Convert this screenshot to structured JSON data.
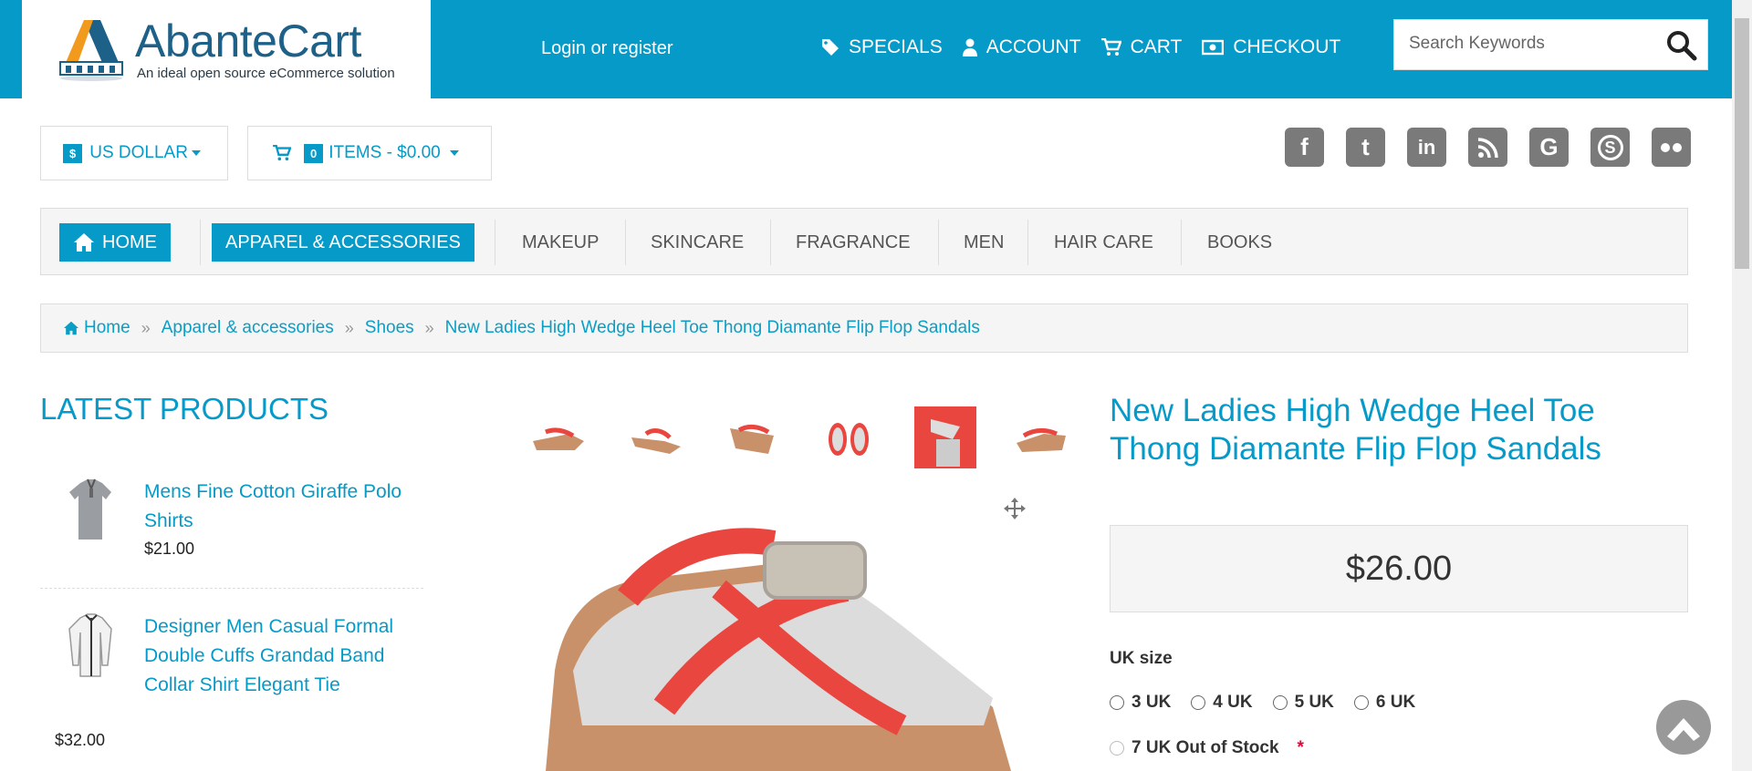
{
  "header": {
    "logo_name": "AbanteCart",
    "logo_tagline": "An ideal open source eCommerce solution",
    "login": "Login or register",
    "nav": [
      {
        "label": "SPECIALS",
        "icon": "tag-icon"
      },
      {
        "label": "ACCOUNT",
        "icon": "user-icon"
      },
      {
        "label": "CART",
        "icon": "cart-icon"
      },
      {
        "label": "CHECKOUT",
        "icon": "money-icon"
      }
    ],
    "search_placeholder": "Search Keywords"
  },
  "toolbar": {
    "currency_badge": "$",
    "currency_label": "US DOLLAR",
    "cart_count": "0",
    "cart_label": "ITEMS - $0.00"
  },
  "social": [
    "facebook-icon",
    "twitter-icon",
    "linkedin-icon",
    "rss-icon",
    "google-icon",
    "skype-icon",
    "flickr-icon"
  ],
  "categories": [
    {
      "label": "HOME",
      "active": true
    },
    {
      "label": "APPAREL & ACCESSORIES",
      "active": true
    },
    {
      "label": "MAKEUP",
      "active": false
    },
    {
      "label": "SKINCARE",
      "active": false
    },
    {
      "label": "FRAGRANCE",
      "active": false
    },
    {
      "label": "MEN",
      "active": false
    },
    {
      "label": "HAIR CARE",
      "active": false
    },
    {
      "label": "BOOKS",
      "active": false
    }
  ],
  "breadcrumb": [
    "Home",
    "Apparel & accessories",
    "Shoes",
    "New Ladies High Wedge Heel Toe Thong Diamante Flip Flop Sandals"
  ],
  "latest": {
    "title": "LATEST PRODUCTS",
    "items": [
      {
        "name": "Mens Fine Cotton Giraffe Polo Shirts",
        "price": "$21.00"
      },
      {
        "name": "Designer Men Casual Formal Double Cuffs Grandad Band Collar Shirt Elegant Tie",
        "price": "$32.00"
      }
    ]
  },
  "product": {
    "title": "New Ladies High Wedge Heel Toe Thong Diamante Flip Flop Sandals",
    "price": "$26.00",
    "option_label": "UK size",
    "options": [
      "3 UK",
      "4 UK",
      "5 UK",
      "6 UK"
    ],
    "option_disabled": "7 UK Out of Stock",
    "required_mark": "*"
  },
  "colors": {
    "brand": "#069ac9",
    "link": "#0a9ec6"
  }
}
